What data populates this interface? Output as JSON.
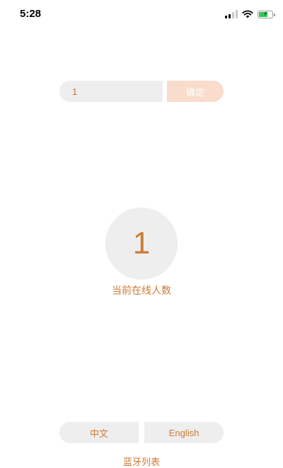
{
  "status_bar": {
    "time": "5:28",
    "icons": [
      "cellular-signal-icon",
      "wifi-icon",
      "battery-charging-icon"
    ]
  },
  "input": {
    "value": "1",
    "confirm_label": "确定"
  },
  "online": {
    "count": "1",
    "label": "当前在线人数"
  },
  "language": {
    "zh_label": "中文",
    "en_label": "English"
  },
  "bluetooth_list_label": "蓝牙列表",
  "colors": {
    "accent": "#cd7b38",
    "button_light": "#f9dccb",
    "field_bg": "#eeeeee",
    "battery_green": "#34c759"
  }
}
